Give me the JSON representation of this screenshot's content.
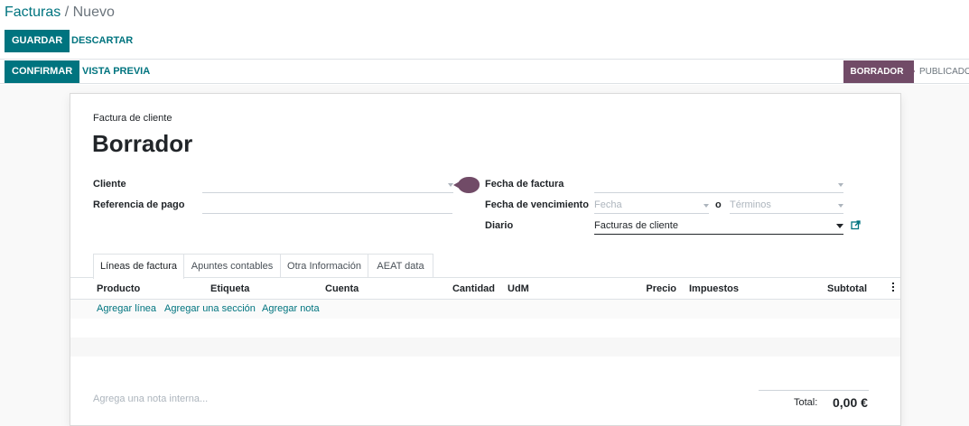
{
  "breadcrumb": {
    "parent": "Facturas",
    "separator": "/",
    "current": "Nuevo"
  },
  "toolbar": {
    "save_label": "GUARDAR",
    "discard_label": "DESCARTAR"
  },
  "actions": {
    "confirm_label": "CONFIRMAR",
    "preview_label": "VISTA PREVIA"
  },
  "status": {
    "active": "BORRADOR",
    "next": "PUBLICADO"
  },
  "form": {
    "subtitle": "Factura de cliente",
    "title": "Borrador",
    "customer_label": "Cliente",
    "payment_ref_label": "Referencia de pago",
    "invoice_date_label": "Fecha de factura",
    "due_date_label": "Fecha de vencimiento",
    "due_date_placeholder": "Fecha",
    "or_label": "o",
    "terms_placeholder": "Términos",
    "journal_label": "Diario",
    "journal_value": "Facturas de cliente"
  },
  "tabs": [
    {
      "label": "Líneas de factura"
    },
    {
      "label": "Apuntes contables"
    },
    {
      "label": "Otra Información"
    },
    {
      "label": "AEAT data"
    }
  ],
  "table": {
    "columns": [
      "Producto",
      "Etiqueta",
      "Cuenta",
      "Cantidad",
      "UdM",
      "Precio",
      "Impuestos",
      "Subtotal"
    ],
    "add_line": "Agregar línea",
    "add_section": "Agregar una sección",
    "add_note": "Agregar nota"
  },
  "footer": {
    "note_placeholder": "Agrega una nota interna...",
    "total_label": "Total:",
    "total_value": "0,00 €"
  },
  "colors": {
    "primary": "#00747f",
    "status_active": "#714b67"
  }
}
